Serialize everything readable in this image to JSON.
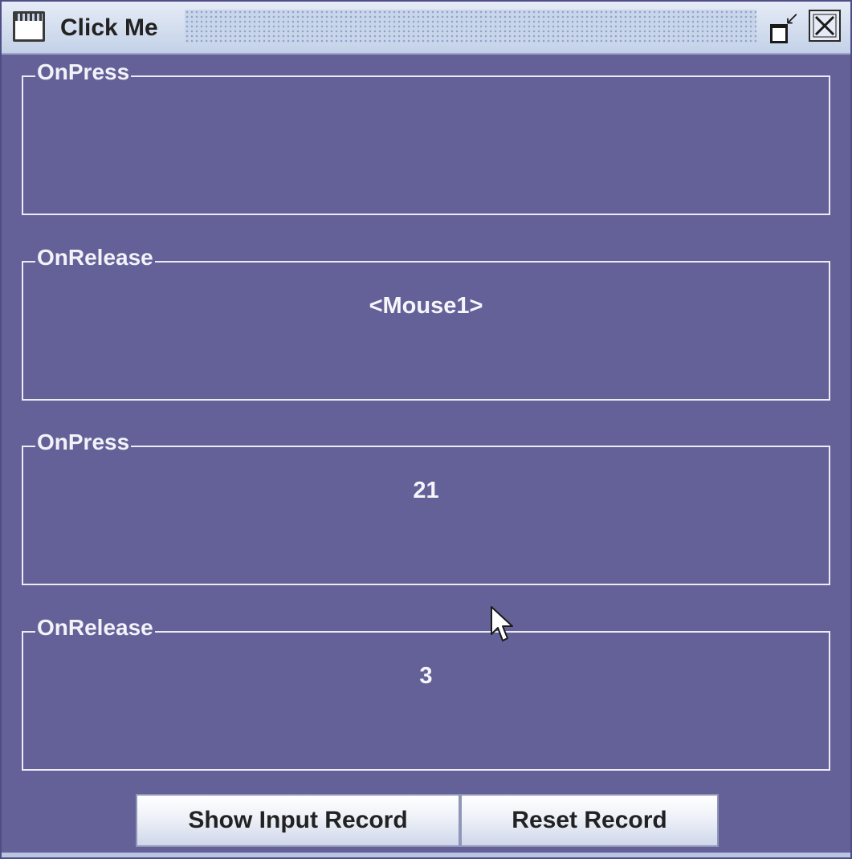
{
  "window": {
    "title": "Click Me"
  },
  "panels": [
    {
      "title": "OnPress",
      "value": ""
    },
    {
      "title": "OnRelease",
      "value": "<Mouse1>"
    },
    {
      "title": "OnPress",
      "value": "21"
    },
    {
      "title": "OnRelease",
      "value": "3"
    }
  ],
  "buttons": {
    "show_input_record": "Show Input Record",
    "reset_record": "Reset Record"
  },
  "colors": {
    "background": "#646199",
    "panel_border": "#ecebf6",
    "text": "#f5f5fa"
  }
}
